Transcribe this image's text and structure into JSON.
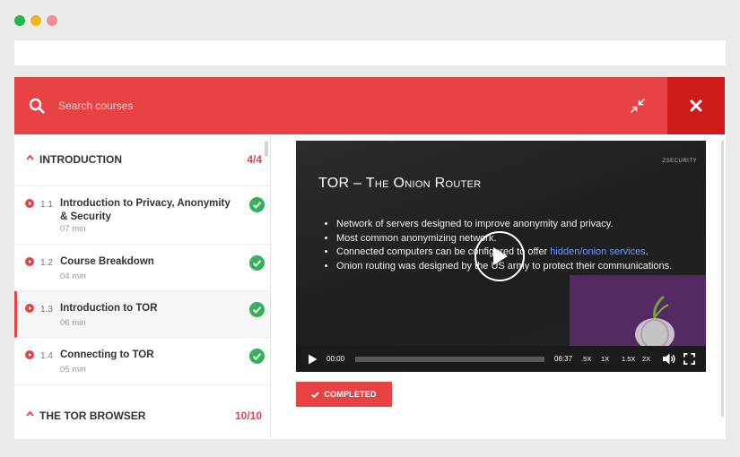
{
  "colors": {
    "accent": "#e84344",
    "close_bg": "#cf1a1a",
    "success": "#34b15a",
    "dot_green": "#27b54d",
    "dot_yellow": "#f2b41a",
    "dot_pink": "#ef8e8e"
  },
  "search": {
    "placeholder": "Search courses",
    "search_icon": "search-icon",
    "collapse_icon": "collapse-icon",
    "close_icon": "close-icon"
  },
  "sidebar": {
    "sections": [
      {
        "title": "INTRODUCTION",
        "count": "4/4",
        "lessons": [
          {
            "number": "1.1",
            "title": "Introduction to Privacy, Anonymity & Security",
            "duration": "07 min",
            "completed": true
          },
          {
            "number": "1.2",
            "title": "Course Breakdown",
            "duration": "04 min",
            "completed": true
          },
          {
            "number": "1.3",
            "title": "Introduction to TOR",
            "duration": "06 min",
            "completed": true
          },
          {
            "number": "1.4",
            "title": "Connecting to TOR",
            "duration": "05 min",
            "completed": true
          }
        ]
      },
      {
        "title": "THE TOR BROWSER",
        "count": "10/10",
        "lessons": []
      }
    ]
  },
  "video": {
    "slide": {
      "logo": "ZSECURITY",
      "title": "TOR – The Onion Router",
      "bullets": {
        "b1": "Network of servers designed to improve anonymity and privacy.",
        "b2": "Most common anonymizing network.",
        "b3_pre": "Connected computers can be configured to offer ",
        "b3_link": "hidden/onion services",
        "b3_post": ".",
        "b4": "Onion routing was designed by the US army to protect their communications."
      }
    },
    "current_time": "00:00",
    "duration": "06:37",
    "progress": 0,
    "speeds": [
      ".5X",
      "1X",
      "1.5X",
      "2X"
    ]
  },
  "completed_button": {
    "label": "COMPLETED"
  }
}
